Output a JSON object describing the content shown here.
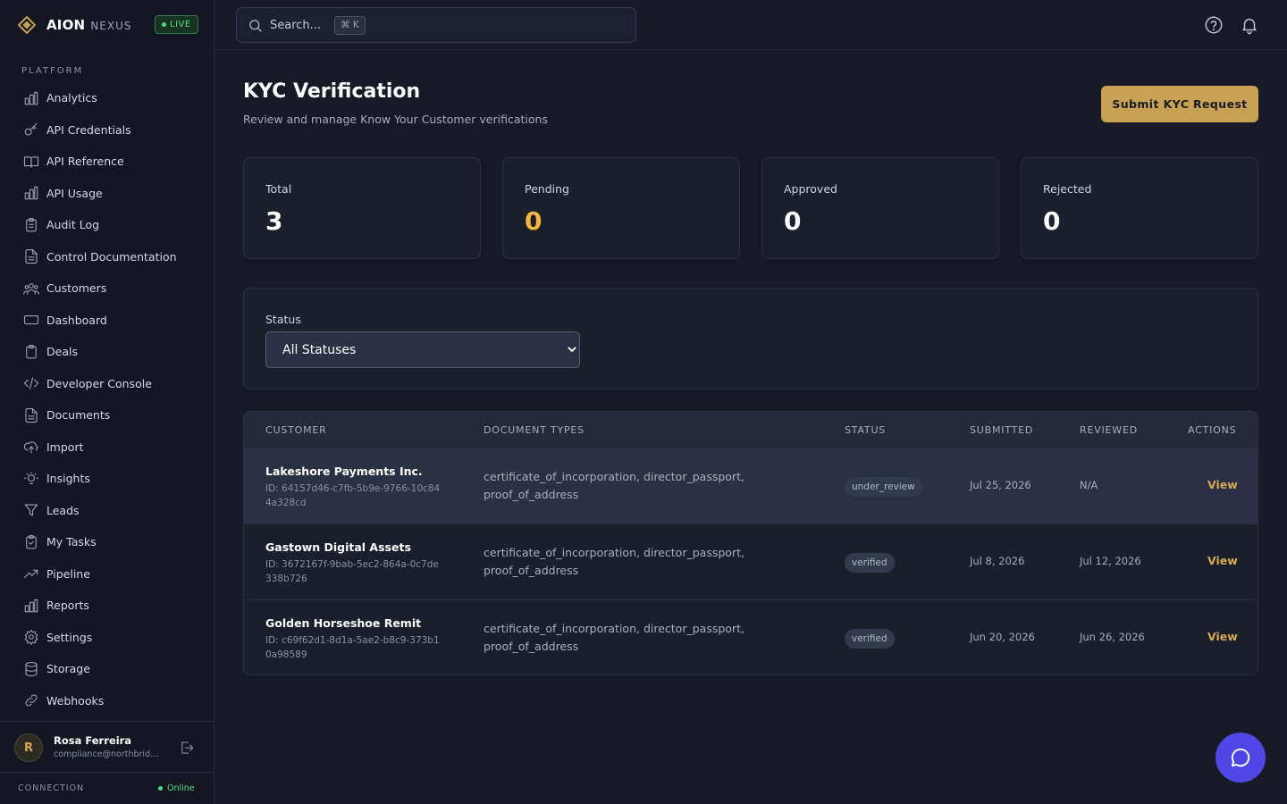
{
  "brand": {
    "name": "AION",
    "sub": "NEXUS",
    "live": "LIVE"
  },
  "sidebar": {
    "section": "PLATFORM",
    "items": [
      {
        "label": "Analytics",
        "icon": "bar-chart-icon"
      },
      {
        "label": "API Credentials",
        "icon": "key-icon"
      },
      {
        "label": "API Reference",
        "icon": "book-open-icon"
      },
      {
        "label": "API Usage",
        "icon": "bar-chart-icon"
      },
      {
        "label": "Audit Log",
        "icon": "clipboard-list-icon"
      },
      {
        "label": "Control Documentation",
        "icon": "file-text-icon"
      },
      {
        "label": "Customers",
        "icon": "users-icon"
      },
      {
        "label": "Dashboard",
        "icon": "monitor-icon"
      },
      {
        "label": "Deals",
        "icon": "clipboard-icon"
      },
      {
        "label": "Developer Console",
        "icon": "code-icon"
      },
      {
        "label": "Documents",
        "icon": "file-text-icon"
      },
      {
        "label": "Import",
        "icon": "upload-cloud-icon"
      },
      {
        "label": "Insights",
        "icon": "lightbulb-icon"
      },
      {
        "label": "Leads",
        "icon": "filter-icon"
      },
      {
        "label": "My Tasks",
        "icon": "clipboard-check-icon"
      },
      {
        "label": "Pipeline",
        "icon": "trending-up-icon"
      },
      {
        "label": "Reports",
        "icon": "bar-chart-icon"
      },
      {
        "label": "Settings",
        "icon": "gear-icon"
      },
      {
        "label": "Storage",
        "icon": "database-icon"
      },
      {
        "label": "Webhooks",
        "icon": "link-icon"
      }
    ]
  },
  "user": {
    "initial": "R",
    "name": "Rosa Ferreira",
    "email": "compliance@northbridg..."
  },
  "connection": {
    "label": "CONNECTION",
    "status": "Online"
  },
  "search": {
    "placeholder": "Search...",
    "shortcut": "⌘ K"
  },
  "header": {
    "title": "KYC Verification",
    "subtitle": "Review and manage Know Your Customer verifications",
    "action": "Submit KYC Request"
  },
  "stats": [
    {
      "label": "Total",
      "value": "3",
      "color": "#ffffff"
    },
    {
      "label": "Pending",
      "value": "0",
      "color": "#f5b73b"
    },
    {
      "label": "Approved",
      "value": "0",
      "color": "#ffffff"
    },
    {
      "label": "Rejected",
      "value": "0",
      "color": "#ffffff"
    }
  ],
  "filter": {
    "label": "Status",
    "selected": "All Statuses"
  },
  "table": {
    "columns": [
      "CUSTOMER",
      "DOCUMENT TYPES",
      "STATUS",
      "SUBMITTED",
      "REVIEWED",
      "ACTIONS"
    ],
    "rows": [
      {
        "name": "Lakeshore Payments Inc.",
        "id": "ID: 64157d46-c7fb-5b9e-9766-10c844a328cd",
        "docs": "certificate_of_incorporation, director_passport, proof_of_address",
        "status": "under_review",
        "submitted": "Jul 25, 2026",
        "reviewed": "N/A",
        "action": "View"
      },
      {
        "name": "Gastown Digital Assets",
        "id": "ID: 3672167f-9bab-5ec2-864a-0c7de338b726",
        "docs": "certificate_of_incorporation, director_passport, proof_of_address",
        "status": "verified",
        "submitted": "Jul 8, 2026",
        "reviewed": "Jul 12, 2026",
        "action": "View"
      },
      {
        "name": "Golden Horseshoe Remit",
        "id": "ID: c69f62d1-8d1a-5ae2-b8c9-373b10a98589",
        "docs": "certificate_of_incorporation, director_passport, proof_of_address",
        "status": "verified",
        "submitted": "Jun 20, 2026",
        "reviewed": "Jun 26, 2026",
        "action": "View"
      }
    ]
  }
}
